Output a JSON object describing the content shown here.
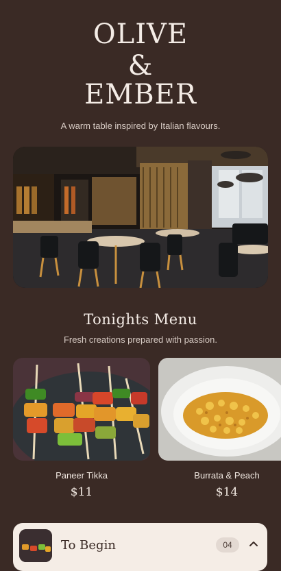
{
  "brand": {
    "line1": "OLIVE",
    "line2": "&",
    "line3": "EMBER"
  },
  "tagline": "A warm table inspired by Italian flavours.",
  "menu": {
    "title": "Tonights Menu",
    "subtitle": "Fresh creations prepared with passion.",
    "dishes": [
      {
        "name": "Paneer Tikka",
        "price": "$11"
      },
      {
        "name": "Burrata & Peach",
        "price": "$14"
      }
    ]
  },
  "accordion": {
    "title": "To Begin",
    "count": "04",
    "icon": "chevron-up-icon"
  },
  "colors": {
    "background": "#3a2a25",
    "card": "#f5ede6",
    "text": "#f3ebe4"
  }
}
